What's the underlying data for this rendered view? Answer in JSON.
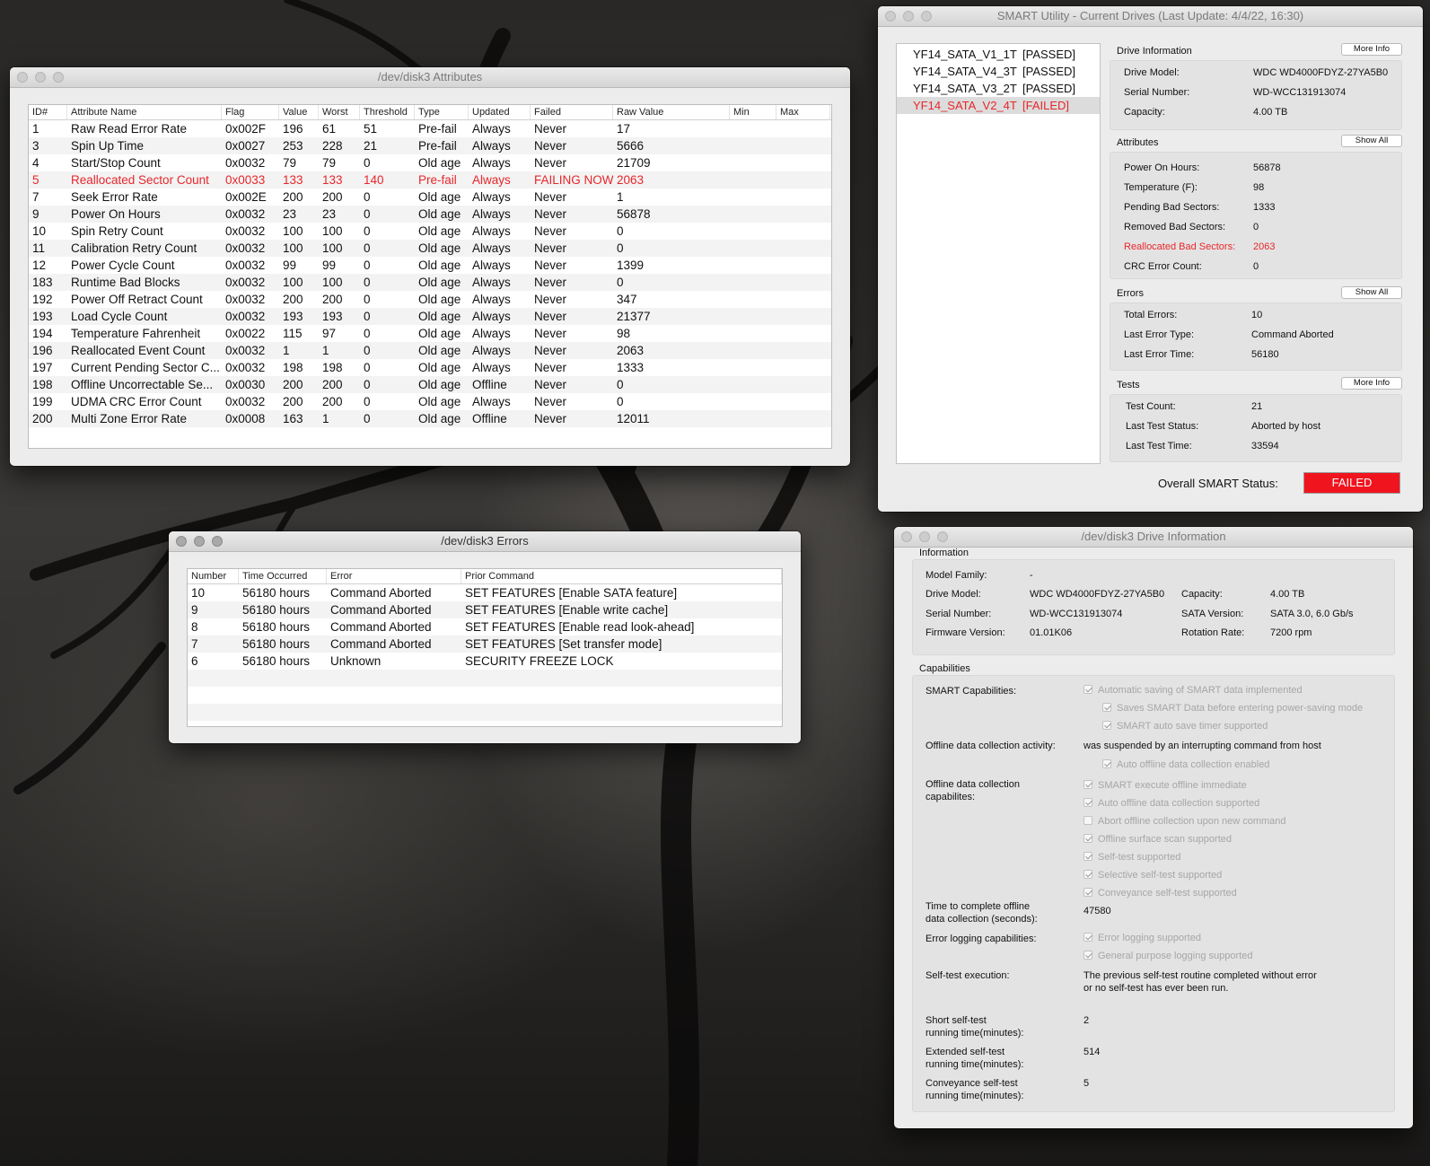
{
  "attributes_window": {
    "title": "/dev/disk3 Attributes",
    "columns": [
      "ID#",
      "Attribute Name",
      "Flag",
      "Value",
      "Worst",
      "Threshold",
      "Type",
      "Updated",
      "Failed",
      "Raw Value",
      "Min",
      "Max"
    ],
    "rows": [
      {
        "id": "1",
        "name": "Raw Read Error Rate",
        "flag": "0x002F",
        "value": "196",
        "worst": "61",
        "threshold": "51",
        "type": "Pre-fail",
        "updated": "Always",
        "failed": "Never",
        "raw": "17",
        "min": "",
        "max": ""
      },
      {
        "id": "3",
        "name": "Spin Up Time",
        "flag": "0x0027",
        "value": "253",
        "worst": "228",
        "threshold": "21",
        "type": "Pre-fail",
        "updated": "Always",
        "failed": "Never",
        "raw": "5666",
        "min": "",
        "max": ""
      },
      {
        "id": "4",
        "name": "Start/Stop Count",
        "flag": "0x0032",
        "value": "79",
        "worst": "79",
        "threshold": "0",
        "type": "Old age",
        "updated": "Always",
        "failed": "Never",
        "raw": "21709",
        "min": "",
        "max": ""
      },
      {
        "id": "5",
        "name": "Reallocated Sector Count",
        "flag": "0x0033",
        "value": "133",
        "worst": "133",
        "threshold": "140",
        "type": "Pre-fail",
        "updated": "Always",
        "failed": "FAILING NOW",
        "raw": "2063",
        "min": "",
        "max": "",
        "alert": true
      },
      {
        "id": "7",
        "name": "Seek Error Rate",
        "flag": "0x002E",
        "value": "200",
        "worst": "200",
        "threshold": "0",
        "type": "Old age",
        "updated": "Always",
        "failed": "Never",
        "raw": "1",
        "min": "",
        "max": ""
      },
      {
        "id": "9",
        "name": "Power On Hours",
        "flag": "0x0032",
        "value": "23",
        "worst": "23",
        "threshold": "0",
        "type": "Old age",
        "updated": "Always",
        "failed": "Never",
        "raw": "56878",
        "min": "",
        "max": ""
      },
      {
        "id": "10",
        "name": "Spin Retry Count",
        "flag": "0x0032",
        "value": "100",
        "worst": "100",
        "threshold": "0",
        "type": "Old age",
        "updated": "Always",
        "failed": "Never",
        "raw": "0",
        "min": "",
        "max": ""
      },
      {
        "id": "11",
        "name": "Calibration Retry Count",
        "flag": "0x0032",
        "value": "100",
        "worst": "100",
        "threshold": "0",
        "type": "Old age",
        "updated": "Always",
        "failed": "Never",
        "raw": "0",
        "min": "",
        "max": ""
      },
      {
        "id": "12",
        "name": "Power Cycle Count",
        "flag": "0x0032",
        "value": "99",
        "worst": "99",
        "threshold": "0",
        "type": "Old age",
        "updated": "Always",
        "failed": "Never",
        "raw": "1399",
        "min": "",
        "max": ""
      },
      {
        "id": "183",
        "name": "Runtime Bad Blocks",
        "flag": "0x0032",
        "value": "100",
        "worst": "100",
        "threshold": "0",
        "type": "Old age",
        "updated": "Always",
        "failed": "Never",
        "raw": "0",
        "min": "",
        "max": ""
      },
      {
        "id": "192",
        "name": "Power Off Retract Count",
        "flag": "0x0032",
        "value": "200",
        "worst": "200",
        "threshold": "0",
        "type": "Old age",
        "updated": "Always",
        "failed": "Never",
        "raw": "347",
        "min": "",
        "max": ""
      },
      {
        "id": "193",
        "name": "Load Cycle Count",
        "flag": "0x0032",
        "value": "193",
        "worst": "193",
        "threshold": "0",
        "type": "Old age",
        "updated": "Always",
        "failed": "Never",
        "raw": "21377",
        "min": "",
        "max": ""
      },
      {
        "id": "194",
        "name": "Temperature Fahrenheit",
        "flag": "0x0022",
        "value": "115",
        "worst": "97",
        "threshold": "0",
        "type": "Old age",
        "updated": "Always",
        "failed": "Never",
        "raw": "98",
        "min": "",
        "max": ""
      },
      {
        "id": "196",
        "name": "Reallocated Event Count",
        "flag": "0x0032",
        "value": "1",
        "worst": "1",
        "threshold": "0",
        "type": "Old age",
        "updated": "Always",
        "failed": "Never",
        "raw": "2063",
        "min": "",
        "max": ""
      },
      {
        "id": "197",
        "name": "Current Pending Sector C...",
        "flag": "0x0032",
        "value": "198",
        "worst": "198",
        "threshold": "0",
        "type": "Old age",
        "updated": "Always",
        "failed": "Never",
        "raw": "1333",
        "min": "",
        "max": ""
      },
      {
        "id": "198",
        "name": "Offline Uncorrectable Se...",
        "flag": "0x0030",
        "value": "200",
        "worst": "200",
        "threshold": "0",
        "type": "Old age",
        "updated": "Offline",
        "failed": "Never",
        "raw": "0",
        "min": "",
        "max": ""
      },
      {
        "id": "199",
        "name": "UDMA CRC Error Count",
        "flag": "0x0032",
        "value": "200",
        "worst": "200",
        "threshold": "0",
        "type": "Old age",
        "updated": "Always",
        "failed": "Never",
        "raw": "0",
        "min": "",
        "max": ""
      },
      {
        "id": "200",
        "name": "Multi Zone Error Rate",
        "flag": "0x0008",
        "value": "163",
        "worst": "1",
        "threshold": "0",
        "type": "Old age",
        "updated": "Offline",
        "failed": "Never",
        "raw": "12011",
        "min": "",
        "max": ""
      }
    ]
  },
  "errors_window": {
    "title": "/dev/disk3 Errors",
    "columns": [
      "Number",
      "Time Occurred",
      "Error",
      "Prior Command"
    ],
    "rows": [
      {
        "number": "10",
        "time": "56180 hours",
        "error": "Command Aborted",
        "command": "SET FEATURES [Enable SATA feature]"
      },
      {
        "number": "9",
        "time": "56180 hours",
        "error": "Command Aborted",
        "command": "SET FEATURES [Enable write cache]"
      },
      {
        "number": "8",
        "time": "56180 hours",
        "error": "Command Aborted",
        "command": "SET FEATURES [Enable read look-ahead]"
      },
      {
        "number": "7",
        "time": "56180 hours",
        "error": "Command Aborted",
        "command": "SET FEATURES [Set transfer mode]"
      },
      {
        "number": "6",
        "time": "56180 hours",
        "error": "Unknown",
        "command": "SECURITY FREEZE LOCK"
      }
    ]
  },
  "smart_window": {
    "title": "SMART Utility - Current Drives (Last Update: 4/4/22, 16:30)",
    "drives": [
      {
        "name": "YF14_SATA_V1_1T",
        "status": "[PASSED]"
      },
      {
        "name": "YF14_SATA_V4_3T",
        "status": "[PASSED]"
      },
      {
        "name": "YF14_SATA_V3_2T",
        "status": "[PASSED]"
      },
      {
        "name": "YF14_SATA_V2_4T",
        "status": "[FAILED]",
        "selected": true
      }
    ],
    "drive_info": {
      "heading": "Drive Information",
      "button": "More Info",
      "model_label": "Drive Model:",
      "model": "WDC WD4000FDYZ-27YA5B0",
      "serial_label": "Serial Number:",
      "serial": "WD-WCC131913074",
      "capacity_label": "Capacity:",
      "capacity": "4.00 TB"
    },
    "attributes": {
      "heading": "Attributes",
      "button": "Show All",
      "items": [
        {
          "label": "Power On Hours:",
          "value": "56878"
        },
        {
          "label": "Temperature (F):",
          "value": "98"
        },
        {
          "label": "Pending Bad Sectors:",
          "value": "1333"
        },
        {
          "label": "Removed Bad Sectors:",
          "value": "0"
        },
        {
          "label": "Reallocated Bad Sectors:",
          "value": "2063",
          "alert": true
        },
        {
          "label": "CRC Error Count:",
          "value": "0"
        }
      ]
    },
    "errors": {
      "heading": "Errors",
      "button": "Show All",
      "items": [
        {
          "label": "Total Errors:",
          "value": "10"
        },
        {
          "label": "Last Error Type:",
          "value": "Command Aborted"
        },
        {
          "label": "Last Error Time:",
          "value": "56180"
        }
      ]
    },
    "tests": {
      "heading": "Tests",
      "button": "More Info",
      "items": [
        {
          "label": "Test Count:",
          "value": "21"
        },
        {
          "label": "Last Test Status:",
          "value": "Aborted by host"
        },
        {
          "label": "Last Test Time:",
          "value": "33594"
        }
      ]
    },
    "overall_label": "Overall SMART Status:",
    "overall_status": "FAILED",
    "status_color": "#f0141f"
  },
  "driveinfo_window": {
    "title": "/dev/disk3 Drive Information",
    "info_heading": "Information",
    "info": {
      "family_label": "Model Family:",
      "family": "-",
      "model_label": "Drive Model:",
      "model": "WDC WD4000FDYZ-27YA5B0",
      "serial_label": "Serial Number:",
      "serial": "WD-WCC131913074",
      "firmware_label": "Firmware Version:",
      "firmware": "01.01K06",
      "capacity_label": "Capacity:",
      "capacity": "4.00 TB",
      "sata_label": "SATA Version:",
      "sata": "SATA 3.0, 6.0 Gb/s",
      "rotation_label": "Rotation Rate:",
      "rotation": "7200 rpm"
    },
    "cap_heading": "Capabilities",
    "smart_cap_label": "SMART Capabilities:",
    "smart_caps": [
      {
        "text": "Automatic saving of SMART data implemented",
        "checked": true
      },
      {
        "text": "Saves SMART Data before entering power-saving mode",
        "checked": true
      },
      {
        "text": "SMART auto save timer supported",
        "checked": true
      }
    ],
    "offline_activity_label": "Offline data collection activity:",
    "offline_activity": "was suspended by an interrupting command from host",
    "auto_offline": {
      "text": "Auto offline data collection enabled",
      "checked": true
    },
    "offline_cap_label1": "Offline data collection",
    "offline_cap_label2": "capabilites:",
    "offline_caps": [
      {
        "text": "SMART execute offline immediate",
        "checked": true
      },
      {
        "text": "Auto offline data collection supported",
        "checked": true
      },
      {
        "text": "Abort offline collection upon new command",
        "checked": false
      },
      {
        "text": "Offline surface scan supported",
        "checked": true
      },
      {
        "text": "Self-test supported",
        "checked": true
      },
      {
        "text": "Selective self-test supported",
        "checked": true
      },
      {
        "text": "Conveyance self-test supported",
        "checked": true
      }
    ],
    "time_label1": "Time to complete offline",
    "time_label2": "data collection (seconds):",
    "time_value": "47580",
    "errlog_label": "Error logging capabilities:",
    "errlog_caps": [
      {
        "text": "Error logging supported",
        "checked": true
      },
      {
        "text": "General purpose logging supported",
        "checked": true
      }
    ],
    "selftest_label": "Self-test execution:",
    "selftest_line1": "The previous self-test routine completed without error",
    "selftest_line2": "or no self-test has ever been run.",
    "short_label1": "Short self-test",
    "short_label2": "running time(minutes):",
    "short_value": "2",
    "extended_label1": "Extended self-test",
    "extended_label2": "running time(minutes):",
    "extended_value": "514",
    "conveyance_label1": "Conveyance self-test",
    "conveyance_label2": "running time(minutes):",
    "conveyance_value": "5"
  }
}
